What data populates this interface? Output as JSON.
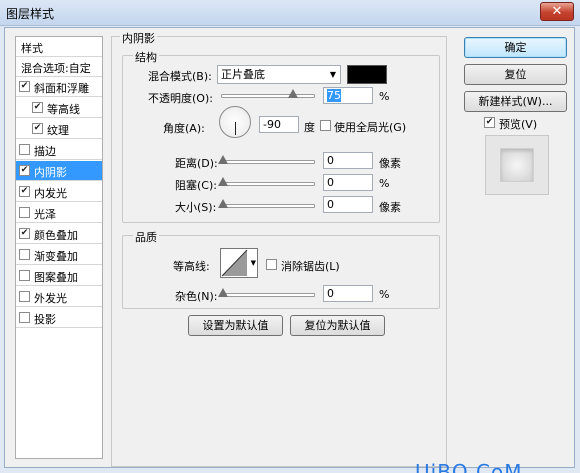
{
  "window": {
    "title": "图层样式",
    "close_glyph": "✕"
  },
  "left_list": {
    "header": "样式",
    "blend_options": "混合选项:自定",
    "items": [
      {
        "label": "斜面和浮雕",
        "checked": true
      },
      {
        "label": "等高线",
        "checked": true
      },
      {
        "label": "纹理",
        "checked": true
      },
      {
        "label": "描边",
        "checked": false
      },
      {
        "label": "内阴影",
        "checked": true
      },
      {
        "label": "内发光",
        "checked": true
      },
      {
        "label": "光泽",
        "checked": false
      },
      {
        "label": "颜色叠加",
        "checked": true
      },
      {
        "label": "渐变叠加",
        "checked": false
      },
      {
        "label": "图案叠加",
        "checked": false
      },
      {
        "label": "外发光",
        "checked": false
      },
      {
        "label": "投影",
        "checked": false
      }
    ]
  },
  "panel": {
    "title": "内阴影",
    "structure": {
      "title": "结构",
      "blend_mode_label": "混合模式(B):",
      "blend_mode_value": "正片叠底",
      "blend_color": "#000000",
      "opacity_label": "不透明度(O):",
      "opacity_value": "75",
      "opacity_unit": "%",
      "opacity_fraction": 0.75,
      "angle_label": "角度(A):",
      "angle_value": "-90",
      "angle_unit": "度",
      "global_light_label": "使用全局光(G)",
      "global_light_checked": false,
      "distance_label": "距离(D):",
      "distance_value": "0",
      "distance_unit": "像素",
      "choke_label": "阻塞(C):",
      "choke_value": "0",
      "choke_unit": "%",
      "size_label": "大小(S):",
      "size_value": "0",
      "size_unit": "像素"
    },
    "quality": {
      "title": "品质",
      "contour_label": "等高线:",
      "anti_alias_label": "消除锯齿(L)",
      "anti_alias_checked": false,
      "noise_label": "杂色(N):",
      "noise_value": "0",
      "noise_unit": "%"
    },
    "make_default": "设置为默认值",
    "reset_default": "复位为默认值"
  },
  "right": {
    "ok": "确定",
    "reset": "复位",
    "new_style": "新建样式(W)...",
    "preview_label": "预览(V)",
    "preview_checked": true
  },
  "watermark": "UiBQ.CoM"
}
